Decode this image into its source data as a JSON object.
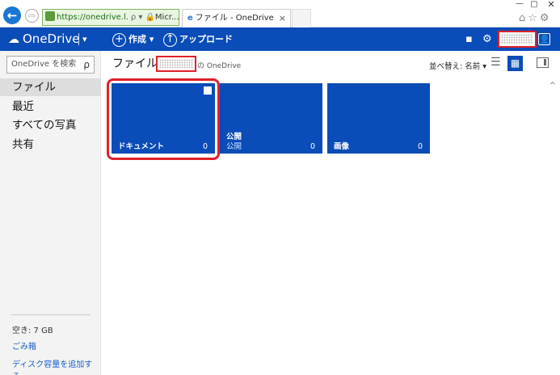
{
  "browser": {
    "back_label": "←",
    "forward_label": "⇨",
    "address_url": "https://onedrive.l.",
    "address_search": "ρ ▾",
    "address_lock": "🔒",
    "address_site": "Micr...",
    "address_refresh": "↻",
    "tab_title": "ファイル - OneDrive",
    "tab_close": "×",
    "window_min": "—",
    "window_max": "▢",
    "window_close": "✕",
    "toolbar_icons": "⌂☆⚙"
  },
  "topbar": {
    "brand": "OneDrive",
    "brand_menu": "▾",
    "create": "作成",
    "create_caret": "▾",
    "upload": "アップロード",
    "feedback_icon": "▪",
    "settings_icon": "⚙",
    "avatar_icon": "👤"
  },
  "sidebar": {
    "search_placeholder": "OneDrive を検索",
    "search_icon": "ρ",
    "items": [
      {
        "label": "ファイル",
        "active": true
      },
      {
        "label": "最近"
      },
      {
        "label": "すべての写真"
      },
      {
        "label": "共有"
      }
    ],
    "quota": "空き: 7 GB",
    "recycle": "ごみ箱",
    "add_storage": "ディスク容量を追加する"
  },
  "main": {
    "title": "ファイル",
    "owner_suffix": "の OneDrive",
    "sort_label": "並べ替え: 名前 ▾",
    "view_list_icon": "☰",
    "view_tile_icon": "▦",
    "scroll_up": "^",
    "tiles": [
      {
        "name": "ドキュメント",
        "count": "0"
      },
      {
        "name": "公開",
        "sub": "公開",
        "count": "0"
      },
      {
        "name": "画像",
        "count": "0"
      }
    ]
  },
  "colors": {
    "brand_blue": "#0a4cb8",
    "highlight_red": "#e0202a"
  }
}
